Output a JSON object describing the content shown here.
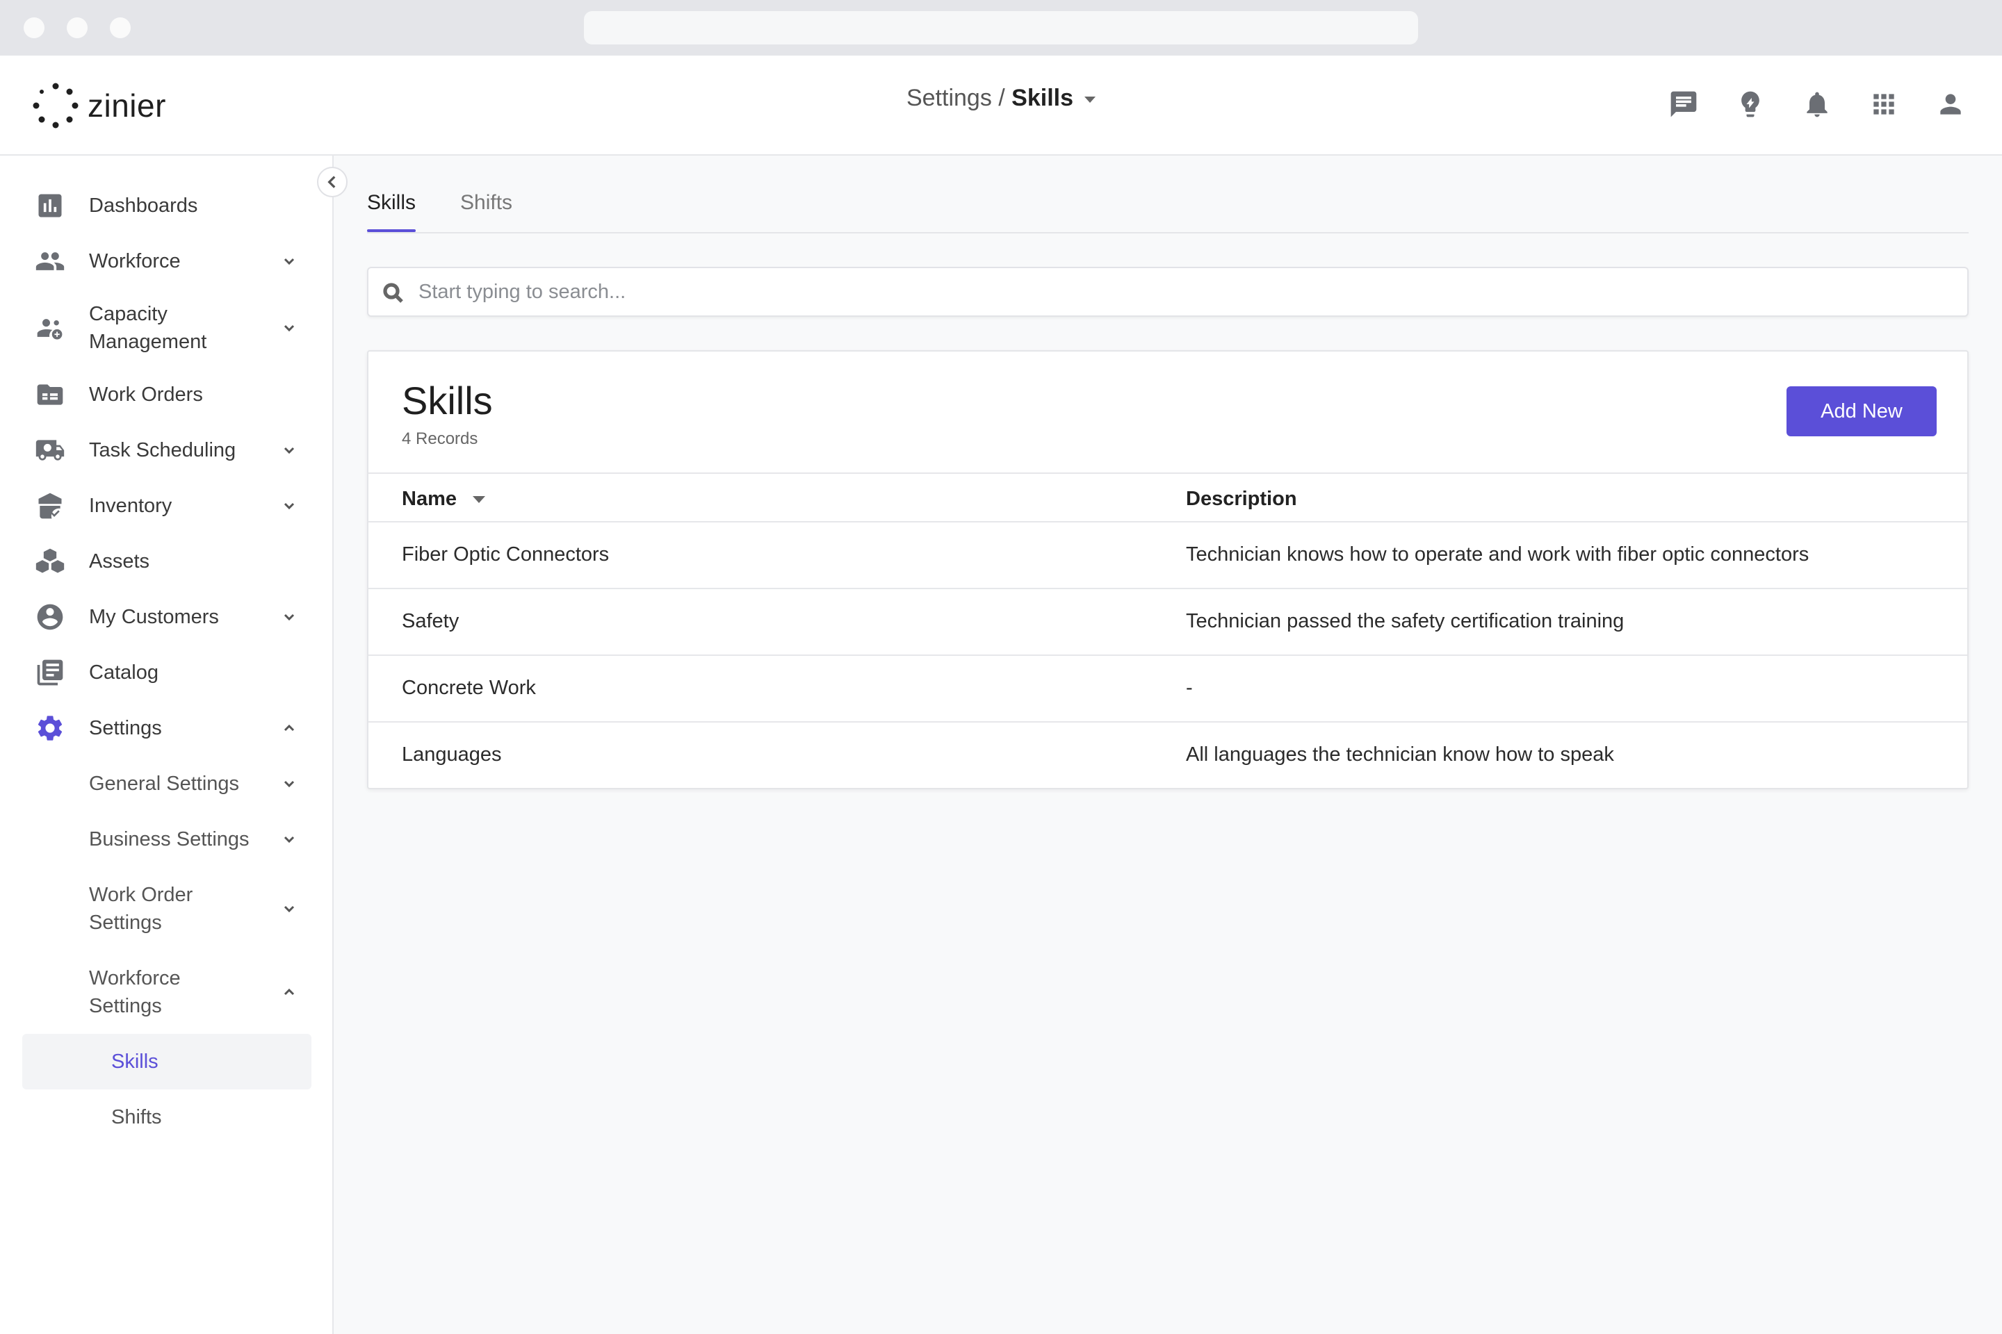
{
  "app": {
    "name": "zinier",
    "breadcrumb_parent": "Settings",
    "breadcrumb_separator": " / ",
    "breadcrumb_current": "Skills"
  },
  "header_icons": [
    "chat-icon",
    "lightbulb-icon",
    "bell-icon",
    "apps-grid-icon",
    "user-icon"
  ],
  "sidebar": {
    "items": [
      {
        "label": "Dashboards",
        "icon": "bar-chart-icon"
      },
      {
        "label": "Workforce",
        "icon": "people-icon"
      },
      {
        "label_line1": "Capacity",
        "label_line2": "Management",
        "icon": "capacity-icon"
      },
      {
        "label": "Work Orders",
        "icon": "work-order-icon"
      },
      {
        "label": "Task Scheduling",
        "icon": "truck-icon"
      },
      {
        "label": "Inventory",
        "icon": "inventory-icon"
      },
      {
        "label": "Assets",
        "icon": "cubes-icon"
      },
      {
        "label": "My Customers",
        "icon": "account-circle-icon"
      },
      {
        "label": "Catalog",
        "icon": "book-icon"
      },
      {
        "label": "Settings",
        "icon": "gear-icon"
      }
    ],
    "settings_children": [
      {
        "label": "General Settings"
      },
      {
        "label": "Business Settings"
      },
      {
        "label_line1": "Work Order",
        "label_line2": "Settings"
      },
      {
        "label_line1": "Workforce",
        "label_line2": "Settings"
      }
    ],
    "workforce_children": [
      {
        "label": "Skills"
      },
      {
        "label": "Shifts"
      }
    ]
  },
  "tabs": [
    {
      "label": "Skills",
      "active": true
    },
    {
      "label": "Shifts",
      "active": false
    }
  ],
  "search": {
    "placeholder": "Start typing to search...",
    "value": ""
  },
  "card": {
    "title": "Skills",
    "record_count": "4 Records",
    "add_button": "Add New"
  },
  "table": {
    "columns": [
      "Name",
      "Description"
    ],
    "rows": [
      {
        "name": "Fiber Optic Connectors",
        "description": "Technician knows how to operate and work with fiber optic connectors"
      },
      {
        "name": "Safety",
        "description": "Technician passed the safety certification training"
      },
      {
        "name": "Concrete Work",
        "description": "-"
      },
      {
        "name": "Languages",
        "description": "All languages the technician know how to speak"
      }
    ]
  },
  "colors": {
    "accent": "#5b4fd8",
    "icon": "#6b6e74",
    "background": "#f8f9fa"
  }
}
